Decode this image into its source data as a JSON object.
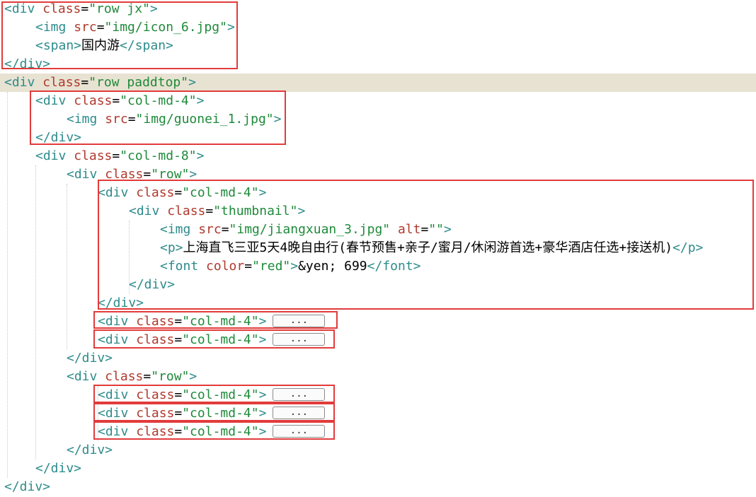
{
  "colors": {
    "tag": "#2e8b8b",
    "attr": "#b03a2e",
    "string": "#1f8a3a",
    "highlight_box": "#e23b3b",
    "current_line_bg": "#e8e2d2"
  },
  "lines": [
    {
      "parts": [
        {
          "t": "tag",
          "v": "<div "
        },
        {
          "t": "attr",
          "v": "class"
        },
        {
          "t": "txt",
          "v": "="
        },
        {
          "t": "str",
          "v": "\"row jx\""
        },
        {
          "t": "tag",
          "v": ">"
        }
      ]
    },
    {
      "parts": [
        {
          "t": "tag",
          "v": "<img "
        },
        {
          "t": "attr",
          "v": "src"
        },
        {
          "t": "txt",
          "v": "="
        },
        {
          "t": "str",
          "v": "\"img/icon_6.jpg\""
        },
        {
          "t": "tag",
          "v": ">"
        }
      ]
    },
    {
      "parts": [
        {
          "t": "tag",
          "v": "<span>"
        },
        {
          "t": "txt",
          "v": "国内游"
        },
        {
          "t": "tag",
          "v": "</span>"
        }
      ]
    },
    {
      "parts": [
        {
          "t": "tag",
          "v": "</div>"
        }
      ]
    },
    {
      "parts": [
        {
          "t": "tag",
          "v": "<div "
        },
        {
          "t": "attr",
          "v": "class"
        },
        {
          "t": "txt",
          "v": "="
        },
        {
          "t": "str",
          "v": "\"row paddtop\""
        },
        {
          "t": "tag",
          "v": ">"
        }
      ]
    },
    {
      "parts": [
        {
          "t": "tag",
          "v": "<div "
        },
        {
          "t": "attr",
          "v": "class"
        },
        {
          "t": "txt",
          "v": "="
        },
        {
          "t": "str",
          "v": "\"col-md-4\""
        },
        {
          "t": "tag",
          "v": ">"
        }
      ]
    },
    {
      "parts": [
        {
          "t": "tag",
          "v": "<img "
        },
        {
          "t": "attr",
          "v": "src"
        },
        {
          "t": "txt",
          "v": "="
        },
        {
          "t": "str",
          "v": "\"img/guonei_1.jpg\""
        },
        {
          "t": "tag",
          "v": ">"
        }
      ]
    },
    {
      "parts": [
        {
          "t": "tag",
          "v": "</div>"
        }
      ]
    },
    {
      "parts": [
        {
          "t": "tag",
          "v": "<div "
        },
        {
          "t": "attr",
          "v": "class"
        },
        {
          "t": "txt",
          "v": "="
        },
        {
          "t": "str",
          "v": "\"col-md-8\""
        },
        {
          "t": "tag",
          "v": ">"
        }
      ]
    },
    {
      "parts": [
        {
          "t": "tag",
          "v": "<div "
        },
        {
          "t": "attr",
          "v": "class"
        },
        {
          "t": "txt",
          "v": "="
        },
        {
          "t": "str",
          "v": "\"row\""
        },
        {
          "t": "tag",
          "v": ">"
        }
      ]
    },
    {
      "parts": [
        {
          "t": "tag",
          "v": "<div "
        },
        {
          "t": "attr",
          "v": "class"
        },
        {
          "t": "txt",
          "v": "="
        },
        {
          "t": "str",
          "v": "\"col-md-4\""
        },
        {
          "t": "tag",
          "v": ">"
        }
      ]
    },
    {
      "parts": [
        {
          "t": "tag",
          "v": "<div "
        },
        {
          "t": "attr",
          "v": "class"
        },
        {
          "t": "txt",
          "v": "="
        },
        {
          "t": "str",
          "v": "\"thumbnail\""
        },
        {
          "t": "tag",
          "v": ">"
        }
      ]
    },
    {
      "parts": [
        {
          "t": "tag",
          "v": "<img "
        },
        {
          "t": "attr",
          "v": "src"
        },
        {
          "t": "txt",
          "v": "="
        },
        {
          "t": "str",
          "v": "\"img/jiangxuan_3.jpg\""
        },
        {
          "t": "txt",
          "v": " "
        },
        {
          "t": "attr",
          "v": "alt"
        },
        {
          "t": "txt",
          "v": "="
        },
        {
          "t": "str",
          "v": "\"\""
        },
        {
          "t": "tag",
          "v": ">"
        }
      ]
    },
    {
      "parts": [
        {
          "t": "tag",
          "v": "<p>"
        },
        {
          "t": "txt",
          "v": "上海直飞三亚5天4晚自由行(春节预售+亲子/蜜月/休闲游首选+豪华酒店任选+接送机)"
        },
        {
          "t": "tag",
          "v": "</p>"
        }
      ]
    },
    {
      "parts": [
        {
          "t": "tag",
          "v": "<font "
        },
        {
          "t": "attr",
          "v": "color"
        },
        {
          "t": "txt",
          "v": "="
        },
        {
          "t": "str",
          "v": "\"red\""
        },
        {
          "t": "tag",
          "v": ">"
        },
        {
          "t": "txt",
          "v": "&yen; 699"
        },
        {
          "t": "tag",
          "v": "</font>"
        }
      ]
    },
    {
      "parts": [
        {
          "t": "tag",
          "v": "</div>"
        }
      ]
    },
    {
      "parts": [
        {
          "t": "tag",
          "v": "</div>"
        }
      ]
    },
    {
      "parts": [
        {
          "t": "tag",
          "v": "<div "
        },
        {
          "t": "attr",
          "v": "class"
        },
        {
          "t": "txt",
          "v": "="
        },
        {
          "t": "str",
          "v": "\"col-md-4\""
        },
        {
          "t": "tag",
          "v": ">"
        }
      ],
      "fold": "..."
    },
    {
      "parts": [
        {
          "t": "tag",
          "v": "<div "
        },
        {
          "t": "attr",
          "v": "class"
        },
        {
          "t": "txt",
          "v": "="
        },
        {
          "t": "str",
          "v": "\"col-md-4\""
        },
        {
          "t": "tag",
          "v": ">"
        }
      ],
      "fold": "..."
    },
    {
      "parts": [
        {
          "t": "tag",
          "v": "</div>"
        }
      ]
    },
    {
      "parts": [
        {
          "t": "tag",
          "v": "<div "
        },
        {
          "t": "attr",
          "v": "class"
        },
        {
          "t": "txt",
          "v": "="
        },
        {
          "t": "str",
          "v": "\"row\""
        },
        {
          "t": "tag",
          "v": ">"
        }
      ]
    },
    {
      "parts": [
        {
          "t": "tag",
          "v": "<div "
        },
        {
          "t": "attr",
          "v": "class"
        },
        {
          "t": "txt",
          "v": "="
        },
        {
          "t": "str",
          "v": "\"col-md-4\""
        },
        {
          "t": "tag",
          "v": ">"
        }
      ],
      "fold": "..."
    },
    {
      "parts": [
        {
          "t": "tag",
          "v": "<div "
        },
        {
          "t": "attr",
          "v": "class"
        },
        {
          "t": "txt",
          "v": "="
        },
        {
          "t": "str",
          "v": "\"col-md-4\""
        },
        {
          "t": "tag",
          "v": ">"
        }
      ],
      "fold": "..."
    },
    {
      "parts": [
        {
          "t": "tag",
          "v": "<div "
        },
        {
          "t": "attr",
          "v": "class"
        },
        {
          "t": "txt",
          "v": "="
        },
        {
          "t": "str",
          "v": "\"col-md-4\""
        },
        {
          "t": "tag",
          "v": ">"
        }
      ],
      "fold": "..."
    },
    {
      "parts": [
        {
          "t": "tag",
          "v": "</div>"
        }
      ]
    },
    {
      "parts": [
        {
          "t": "tag",
          "v": "</div>"
        }
      ]
    },
    {
      "parts": [
        {
          "t": "tag",
          "v": "</div>"
        }
      ]
    }
  ]
}
